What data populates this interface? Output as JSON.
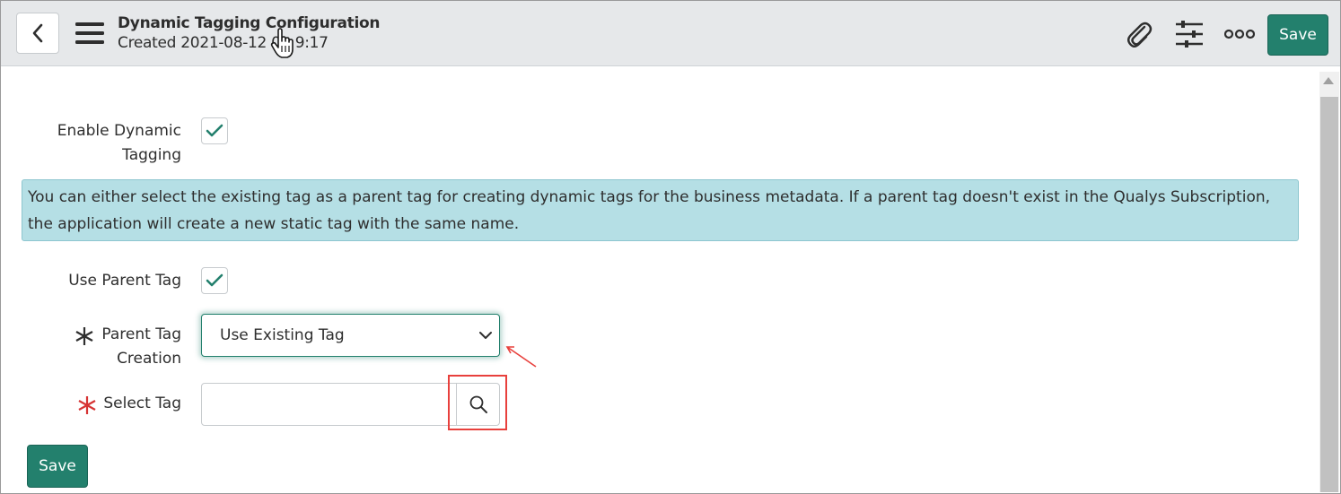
{
  "header": {
    "title": "Dynamic Tagging Configuration",
    "subtitle": "Created 2021-08-12 0",
    "subtitle_end": "9:17",
    "save_label": "Save",
    "icons": [
      "back-arrow-icon",
      "hamburger-menu-icon",
      "paperclip-icon",
      "sliders-icon",
      "more-options-icon"
    ]
  },
  "form": {
    "enable_dynamic_tagging": {
      "label_line1": "Enable Dynamic",
      "label_line2": "Tagging",
      "checked": true
    },
    "info_message": "You can either select the existing tag as a parent tag for creating dynamic tags for the business metadata. If a parent tag doesn't exist in the Qualys Subscription, the application will create a new static tag with the same name.",
    "use_parent_tag": {
      "label": "Use Parent Tag",
      "checked": true
    },
    "parent_tag_creation": {
      "label_line1": "Parent Tag",
      "label_line2": "Creation",
      "mandatory_mark": "*",
      "selected": "Use Existing Tag"
    },
    "select_tag": {
      "label": "Select Tag",
      "mandatory_mark": "*",
      "value": ""
    },
    "save_label": "Save"
  },
  "colors": {
    "accent": "#23806d",
    "info_background": "#b5dfe5",
    "required_mark": "#d63333",
    "annotation_red": "#e8403c"
  }
}
